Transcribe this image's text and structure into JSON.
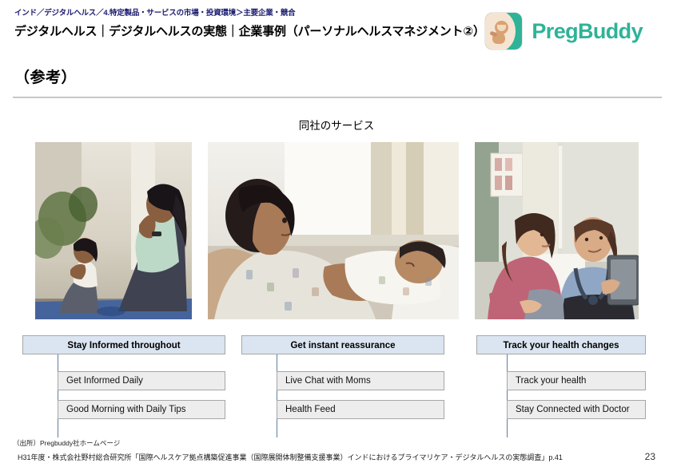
{
  "header": {
    "breadcrumb": "インド／デジタルヘルス／4.特定製品・サービスの市場・投資環境＞主要企業・競合",
    "title": "デジタルヘルス｜デジタルヘルスの実態｜企業事例（パーソナルヘルスマネジメント②）",
    "logo_text": "PregBuddy",
    "logo_icon": "pregbuddy-baby-icon",
    "logo_color": "#2fb398"
  },
  "section": {
    "heading": "（参考）"
  },
  "content": {
    "subtitle": "同社のサービス",
    "photos": [
      {
        "name": "prenatal-yoga-photo",
        "alt": "妊婦が子どもとヨガの合掌ポーズをしている写真"
      },
      {
        "name": "newborn-in-hospital-photo",
        "alt": "病室のベッドで新生児を抱く母親の写真"
      },
      {
        "name": "doctor-consultation-photo",
        "alt": "タブレットを持つ医師と妊婦が話している写真"
      }
    ],
    "columns": [
      {
        "name": "stay-informed",
        "header": "Stay Informed throughout",
        "items": [
          "Get Informed Daily",
          "Good Morning with Daily Tips"
        ]
      },
      {
        "name": "instant-reassurance",
        "header": "Get instant reassurance",
        "items": [
          "Live Chat with Moms",
          "Health Feed"
        ]
      },
      {
        "name": "track-health-changes",
        "header": "Track your health changes",
        "items": [
          "Track your health",
          "Stay Connected with Doctor"
        ]
      }
    ]
  },
  "footer": {
    "source_note": "（出所）Pregbuddy社ホームページ",
    "footnote": "H31年度・株式会社野村総合研究所「国際ヘルスケア拠点構築促進事業（国際展開体制整備支援事業）インドにおけるプライマリケア・デジタルヘルスの実態調査」p.41",
    "page_number": "23"
  },
  "colors": {
    "breadcrumb": "#1a1a6e",
    "brand": "#2fb398",
    "header_box": "#dbe5f1",
    "sub_box": "#ededed",
    "box_border": "#a6a6a6",
    "connector": "#5f7f9f",
    "divider": "#c8c8c8"
  }
}
